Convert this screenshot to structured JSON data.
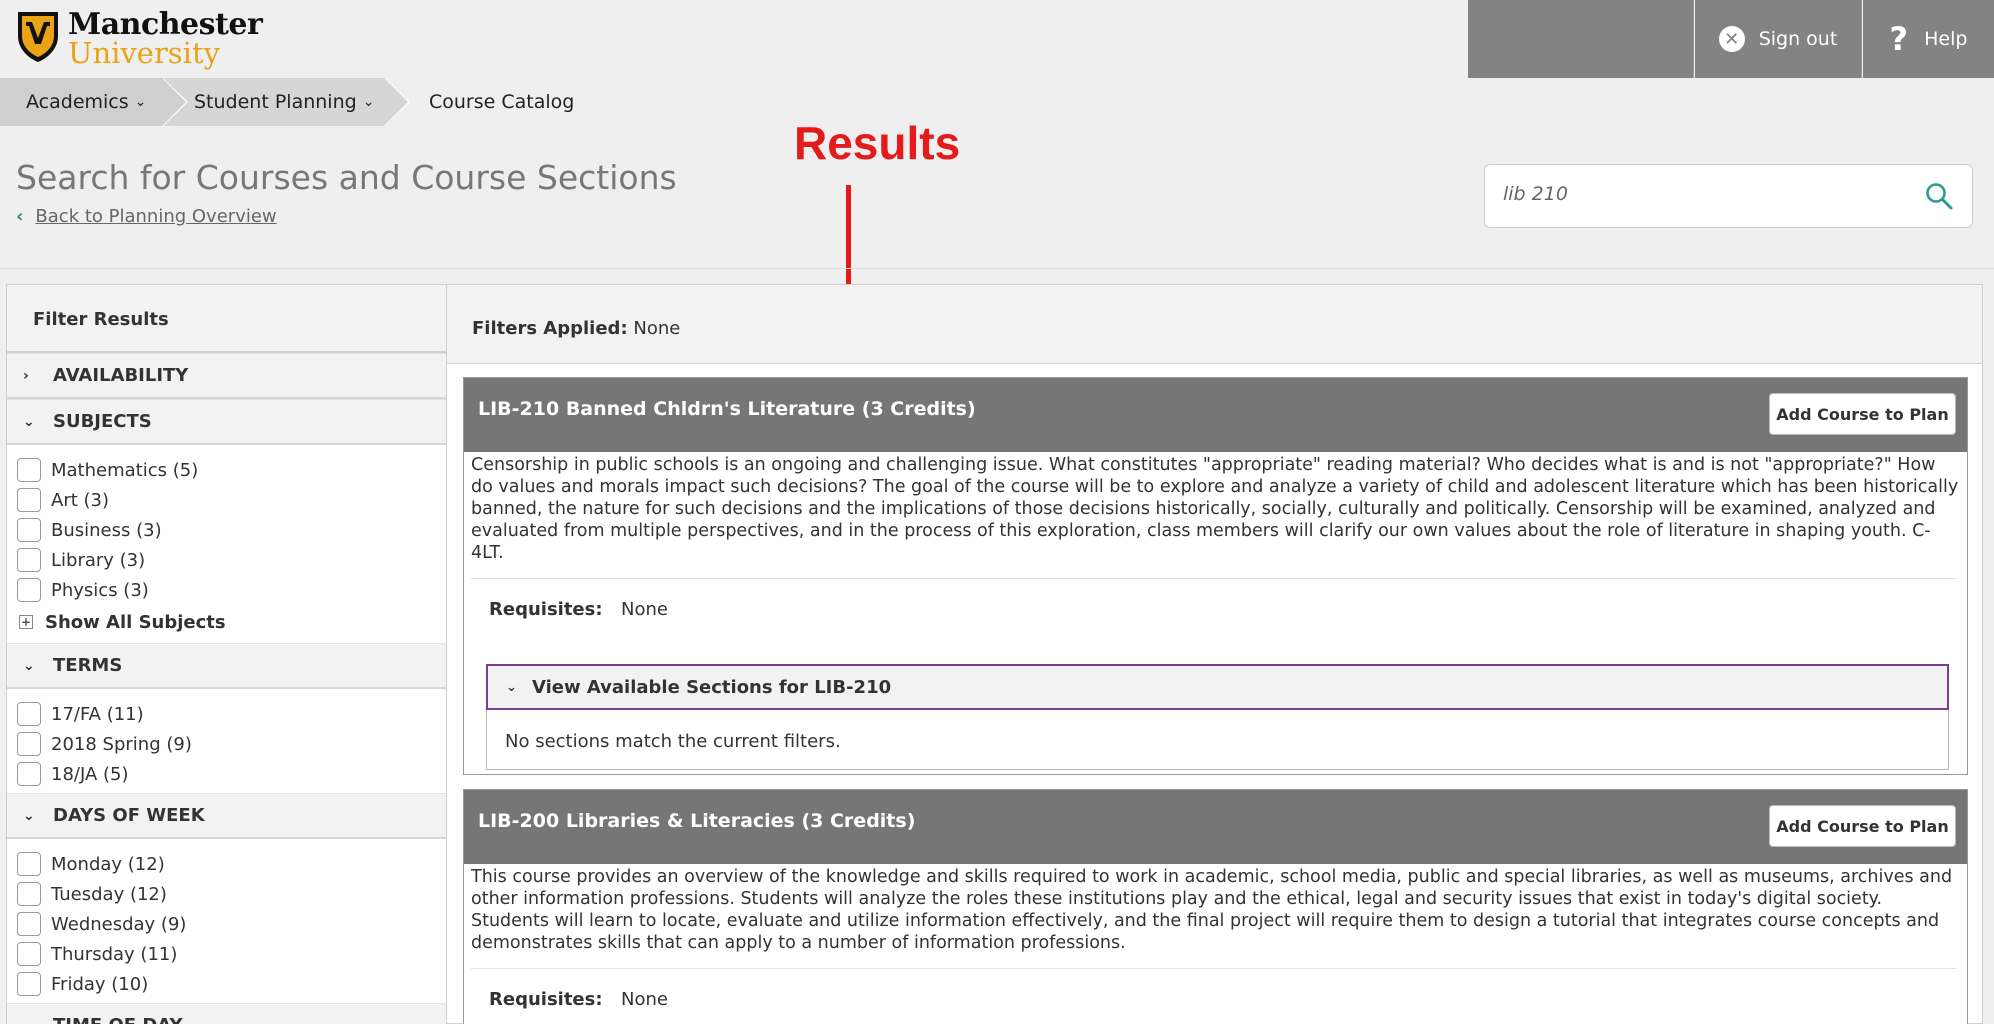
{
  "header": {
    "logo": {
      "line1": "Manchester",
      "line2": "University"
    },
    "sign_out_label": "Sign out",
    "help_label": "Help"
  },
  "breadcrumb": {
    "items": [
      {
        "label": "Academics"
      },
      {
        "label": "Student Planning"
      },
      {
        "label": "Course Catalog"
      }
    ]
  },
  "page": {
    "title": "Search for Courses and Course Sections",
    "back_link": "Back to Planning Overview"
  },
  "annotation": {
    "label": "Results"
  },
  "search": {
    "value": "lib 210"
  },
  "sidebar": {
    "title": "Filter Results",
    "sections": [
      {
        "label": "AVAILABILITY",
        "expanded": false
      },
      {
        "label": "SUBJECTS",
        "expanded": true,
        "options": [
          "Mathematics (5)",
          "Art (3)",
          "Business (3)",
          "Library (3)",
          "Physics (3)"
        ],
        "show_all": "Show All Subjects"
      },
      {
        "label": "TERMS",
        "expanded": true,
        "options": [
          "17/FA (11)",
          "2018 Spring (9)",
          "18/JA (5)"
        ]
      },
      {
        "label": "DAYS OF WEEK",
        "expanded": true,
        "options": [
          "Monday (12)",
          "Tuesday (12)",
          "Wednesday (9)",
          "Thursday (11)",
          "Friday (10)"
        ]
      },
      {
        "label": "TIME OF DAY",
        "expanded": true
      }
    ]
  },
  "results": {
    "filters_applied_label": "Filters Applied:",
    "filters_applied_value": "None",
    "courses": [
      {
        "title": "LIB-210 Banned Chldrn's Literature (3 Credits)",
        "add_label": "Add Course to Plan",
        "description": "Censorship in public schools is an ongoing and challenging issue. What constitutes \"appropriate\" reading material? Who decides what is and is not \"appropriate?\" How do values and morals impact such decisions? The goal of the course will be to explore and analyze a variety of child and adolescent literature which has been historically banned, the nature for such decisions and the implications of those decisions historically, socially, culturally and politically. Censorship will be examined, analyzed and evaluated from multiple perspectives, and in the process of this exploration, class members will clarify our own values about the role of literature in shaping youth. C-4LT.",
        "requisites_label": "Requisites:",
        "requisites_value": "None",
        "sections_toggle": "View Available Sections for LIB-210",
        "no_sections": "No sections match the current filters."
      },
      {
        "title": "LIB-200 Libraries & Literacies (3 Credits)",
        "add_label": "Add Course to Plan",
        "description": "This course provides an overview of the knowledge and skills required to work in academic, school media, public and special libraries, as well as museums, archives and other information professions. Students will analyze the roles these institutions play and the ethical, legal and security issues that exist in today's digital society. Students will learn to locate, evaluate and utilize information effectively, and the final project will require them to design a tutorial that integrates course concepts and demonstrates skills that can apply to a number of information professions.",
        "requisites_label": "Requisites:",
        "requisites_value": "None"
      }
    ]
  },
  "colors": {
    "accent_gold": "#e8a317",
    "header_gray": "#838383",
    "course_header": "#767676",
    "annotation_red": "#e31b1b",
    "focus_purple": "#7a3d8f",
    "link_teal": "#2b8a84"
  },
  "icons": [
    "shield-logo-icon",
    "close-circle-icon",
    "question-icon",
    "chevron-down-icon",
    "chevron-left-icon",
    "search-icon",
    "chevron-right-icon",
    "plus-box-icon"
  ]
}
